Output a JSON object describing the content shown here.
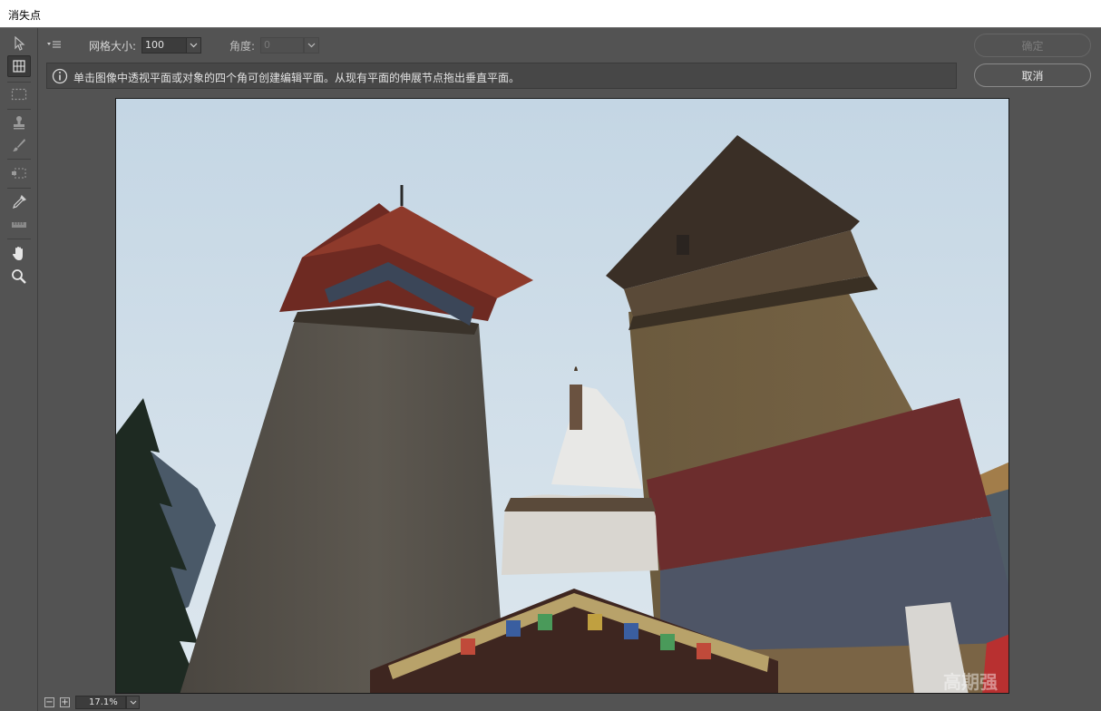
{
  "window": {
    "title": "消失点"
  },
  "tools": [
    {
      "name": "edit-plane-tool-icon"
    },
    {
      "name": "create-plane-tool-icon"
    },
    {
      "name": "marquee-tool-icon"
    },
    {
      "name": "stamp-tool-icon"
    },
    {
      "name": "brush-tool-icon"
    },
    {
      "name": "transform-tool-icon"
    },
    {
      "name": "eyedropper-tool-icon"
    },
    {
      "name": "measure-tool-icon"
    },
    {
      "name": "hand-tool-icon"
    },
    {
      "name": "zoom-tool-icon"
    }
  ],
  "options": {
    "grid_size_label": "网格大小:",
    "grid_size_value": "100",
    "angle_label": "角度:",
    "angle_value": "0"
  },
  "info": {
    "message": "单击图像中透视平面或对象的四个角可创建编辑平面。从现有平面的伸展节点拖出垂直平面。"
  },
  "buttons": {
    "ok_label": "确定",
    "cancel_label": "取消"
  },
  "status": {
    "zoom_out": "−",
    "zoom_in": "+",
    "zoom_value": "17.1%"
  },
  "watermark": "高期强",
  "colors": {
    "panel_bg": "#535353",
    "sky": "#cbdbe6"
  }
}
